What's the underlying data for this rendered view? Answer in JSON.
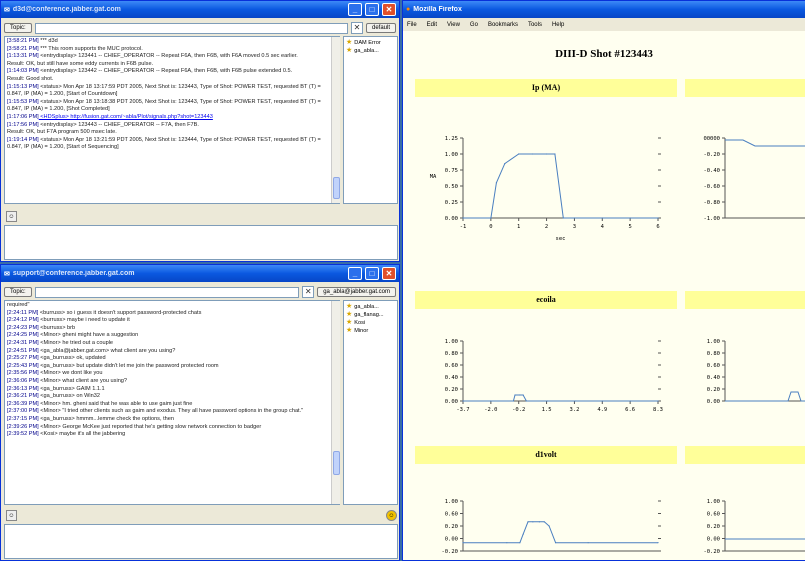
{
  "chat1": {
    "title": "d3d@conference.jabber.gat.com",
    "topic_label": "Topic:",
    "default_label": "default",
    "roster": [
      "DAM Error",
      "ga_abla..."
    ],
    "lines": [
      {
        "ts": "[3:58:21 PM]",
        "text": " *** d3d"
      },
      {
        "ts": "[3:58:21 PM]",
        "text": " *** This room supports the MUC protocol."
      },
      {
        "ts": "[1:13:31 PM]",
        "text": " <entrydisplay>      123441 -- CHIEF_OPERATOR -- Repeat F6A, then F6B, with F6A moved 0.5 sec earlier."
      },
      {
        "ts": "",
        "text": "Result:  OK, but still have some eddy currents in F6B pulse."
      },
      {
        "ts": "[1:14:03 PM]",
        "text": " <entrydisplay>      123442 -- CHIEF_OPERATOR -- Repeat F6A, then F6B, with F6B pulse extended 0.5."
      },
      {
        "ts": "",
        "text": "Result:  Good shot."
      },
      {
        "ts": "[1:15:13 PM]",
        "text": " <status> Mon Apr 18 13:17:59 PDT 2005, Next Shot is: 123443, Type of Shot: POWER TEST, requested BT (T) = 0.847, IP (MA) = 1.200, [Start of Countdown]"
      },
      {
        "ts": "[1:15:53 PM]",
        "text": " <status> Mon Apr 18 13:18:38 PDT 2005, Next Shot is: 123443, Type of Shot: POWER TEST, requested BT (T) = 0.847, IP (MA) = 1.200, [Shot Completed]"
      },
      {
        "ts": "[1:17:06 PM]",
        "text": " <HDSplus> http://fusion.gat.com/~abla/Plot/signals.php?shot=123443"
      },
      {
        "ts": "[1:17:56 PM]",
        "text": " <entrydisplay>      123443 -- CHIEF_OPERATOR -- F7A, then F7B."
      },
      {
        "ts": "",
        "text": "Result:  OK, but F7A program 500 msec late."
      },
      {
        "ts": "[1:19:14 PM]",
        "text": " <status> Mon Apr 18 13:21:59 PDT 2005, Next Shot is: 123444, Type of Shot: POWER TEST, requested BT (T) = 0.847, IP (MA) = 1.200, [Start of Sequencing]"
      }
    ]
  },
  "chat2": {
    "title": "support@conference.jabber.gat.com",
    "topic_label": "Topic:",
    "user_label": "ga_abla@jabber.gat.com",
    "roster": [
      "ga_abla...",
      "ga_flanag...",
      "Kosi",
      "Minor"
    ],
    "lines": [
      {
        "ts": "",
        "text": "required\""
      },
      {
        "ts": "[2:24:11 PM]",
        "text": " <burruss> so i guess it doesn't support password-protected chats"
      },
      {
        "ts": "[2:24:12 PM]",
        "text": " <burruss> maybe i need to update it"
      },
      {
        "ts": "[2:24:23 PM]",
        "text": " <burruss> brb"
      },
      {
        "ts": "[2:24:25 PM]",
        "text": " <Minor> gheni might have a suggestion"
      },
      {
        "ts": "[2:24:31 PM]",
        "text": " <Minor> he tried out a couple"
      },
      {
        "ts": "[2:24:51 PM]",
        "text": " <ga_abla@jabber.gat.com> what client are you using?"
      },
      {
        "ts": "[2:25:27 PM]",
        "text": " <ga_burruss> ok, updated"
      },
      {
        "ts": "[2:25:43 PM]",
        "text": " <ga_burruss> but update didn't let me join the password protected room"
      },
      {
        "ts": "[2:35:56 PM]",
        "text": " <Minor> we dont like you"
      },
      {
        "ts": "[2:36:06 PM]",
        "text": " <Minor> what client are you using?"
      },
      {
        "ts": "[2:36:13 PM]",
        "text": " <ga_burruss> GAIM 1.1.1"
      },
      {
        "ts": "[2:36:21 PM]",
        "text": " <ga_burruss> on Win32"
      },
      {
        "ts": "[2:36:39 PM]",
        "text": " <Minor> hm. gheni said that he was able to use gaim just fine"
      },
      {
        "ts": "[2:37:00 PM]",
        "text": " <Minor> \"I tried other clients such as gaim and exodus. They all have password options in the group chat.\""
      },
      {
        "ts": "[2:37:15 PM]",
        "text": " <ga_burruss> hmmm...lemme check the options, then"
      },
      {
        "ts": "",
        "text": ""
      },
      {
        "ts": "[2:39:26 PM]",
        "text": " <Minor> George McKee just reported that he's getting slow network connection to badger"
      },
      {
        "ts": "[2:39:52 PM]",
        "text": " <Kosi> maybe it's all the jabbering"
      }
    ]
  },
  "firefox": {
    "title": "Mozilla Firefox",
    "menu": [
      "File",
      "Edit",
      "View",
      "Go",
      "Bookmarks",
      "Tools",
      "Help"
    ],
    "page_title": "DIII-D Shot #123443",
    "panels": [
      "Ip (MA)",
      "ecoila",
      "d1volt"
    ]
  },
  "colors": {
    "titlebar": "#0a58e0",
    "panel_header": "#ffff99",
    "trace": "#4a7fc0",
    "link": "#0000ee"
  },
  "chart_data": [
    {
      "type": "line",
      "title": "Ip (MA)",
      "xlabel": "sec",
      "ylabel": "MA",
      "x": [
        -1,
        0,
        0.2,
        0.5,
        1,
        1.5,
        2,
        2.3,
        2.6,
        3,
        4,
        5,
        6
      ],
      "values": [
        0,
        0,
        0.55,
        0.85,
        1.0,
        1.0,
        1.0,
        1.0,
        0,
        0,
        0,
        0,
        0
      ],
      "yticks": [
        "1.25",
        "1.00",
        "0.75",
        "0.50",
        "0.25",
        "0.00"
      ],
      "xticks": [
        "-1",
        "0",
        "1",
        "2",
        "3",
        "4",
        "5",
        "6"
      ]
    },
    {
      "type": "line",
      "title": "ecoila",
      "x": [
        -3.7,
        -2,
        -0.6,
        -0.5,
        -0.2,
        0,
        0.2,
        1.5,
        3.2,
        4.9,
        6.6,
        8.3
      ],
      "values": [
        0,
        0,
        0,
        0.1,
        0.1,
        0.1,
        0,
        0,
        0,
        0,
        0,
        0
      ],
      "yticks": [
        "1.00",
        "0.80",
        "0.60",
        "0.40",
        "0.20",
        "0.00"
      ],
      "xticks": [
        "-3.7",
        "-2.0",
        "-0.2",
        "1.5",
        "3.2",
        "4.9",
        "6.6",
        "8.3"
      ]
    },
    {
      "type": "line",
      "title": "d1volt",
      "x": [
        -3.7,
        -1,
        -0.2,
        0,
        0.3,
        0.6,
        1,
        1.3,
        1.6,
        2,
        4,
        8.3
      ],
      "values": [
        0,
        0,
        0,
        0.2,
        0.5,
        0.5,
        0.5,
        0.5,
        0.4,
        0,
        0,
        0
      ],
      "yticks": [
        "1.00",
        "0.60",
        "0.20",
        "0.00",
        "-0.20"
      ]
    }
  ]
}
